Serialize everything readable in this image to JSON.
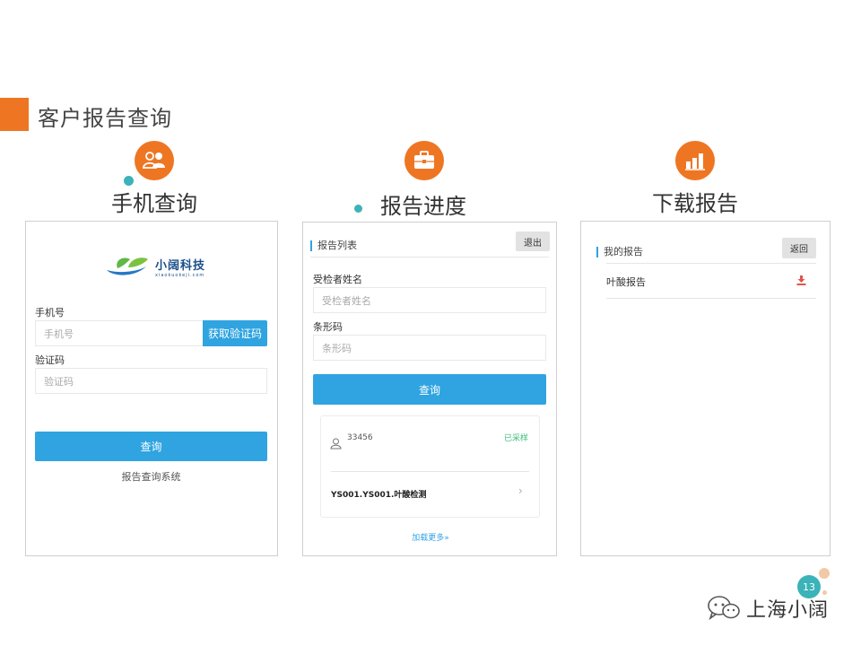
{
  "slide": {
    "title": "客户报告查询",
    "page_number": "13",
    "accent": "#ee7623",
    "teal": "#3bb3b8"
  },
  "sections": [
    {
      "heading": "手机查询",
      "icon": "users-icon"
    },
    {
      "heading": "报告进度",
      "icon": "briefcase-icon"
    },
    {
      "heading": "下载报告",
      "icon": "bar-chart-icon"
    }
  ],
  "phone_query": {
    "logo_text": "小阔科技",
    "logo_subtext": "xiaokuokeji.com",
    "phone_label": "手机号",
    "phone_placeholder": "手机号",
    "get_code_button": "获取验证码",
    "code_label": "验证码",
    "code_placeholder": "验证码",
    "query_button": "查询",
    "footer_text": "报告查询系统"
  },
  "report_progress": {
    "title": "报告列表",
    "logout_button": "退出",
    "name_label": "受检者姓名",
    "name_placeholder": "受检者姓名",
    "barcode_label": "条形码",
    "barcode_placeholder": "条形码",
    "query_button": "查询",
    "card": {
      "id": "33456",
      "status": "已采样",
      "name": "YS001.YS001.叶酸检测"
    },
    "load_more": "加载更多»"
  },
  "download_report": {
    "title": "我的报告",
    "back_button": "返回",
    "items": [
      {
        "label": "叶酸报告"
      }
    ]
  },
  "watermark": {
    "text": "上海小阔",
    "icon": "wechat-icon"
  }
}
